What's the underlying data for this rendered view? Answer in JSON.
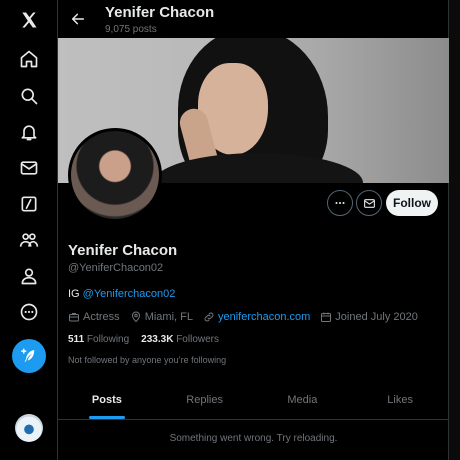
{
  "rail": {
    "items": [
      {
        "icon": "x-logo-icon"
      },
      {
        "icon": "home-icon"
      },
      {
        "icon": "search-icon"
      },
      {
        "icon": "bell-icon"
      },
      {
        "icon": "mail-icon"
      },
      {
        "icon": "grok-icon"
      },
      {
        "icon": "communities-icon"
      },
      {
        "icon": "profile-icon"
      },
      {
        "icon": "more-icon"
      }
    ],
    "compose_icon": "feather-plus-icon"
  },
  "header": {
    "name": "Yenifer Chacon",
    "posts_count": "9,075 posts"
  },
  "profile": {
    "name": "Yenifer Chacon",
    "handle": "@YeniferChacon02",
    "bio_prefix": "IG ",
    "bio_link": "@Yeniferchacon02",
    "category": "Actress",
    "location": "Miami, FL",
    "website": "yeniferchacon.com",
    "joined": "Joined July 2020",
    "following_count": "511",
    "following_label": "Following",
    "followers_count": "233.3K",
    "followers_label": "Followers",
    "not_followed": "Not followed by anyone you’re following",
    "follow_label": "Follow"
  },
  "tabs": [
    {
      "label": "Posts",
      "active": true
    },
    {
      "label": "Replies",
      "active": false
    },
    {
      "label": "Media",
      "active": false
    },
    {
      "label": "Likes",
      "active": false
    }
  ],
  "error_message": "Something went wrong. Try reloading.",
  "colors": {
    "accent": "#1d9bf0",
    "background": "#000000",
    "muted": "#71767b"
  }
}
